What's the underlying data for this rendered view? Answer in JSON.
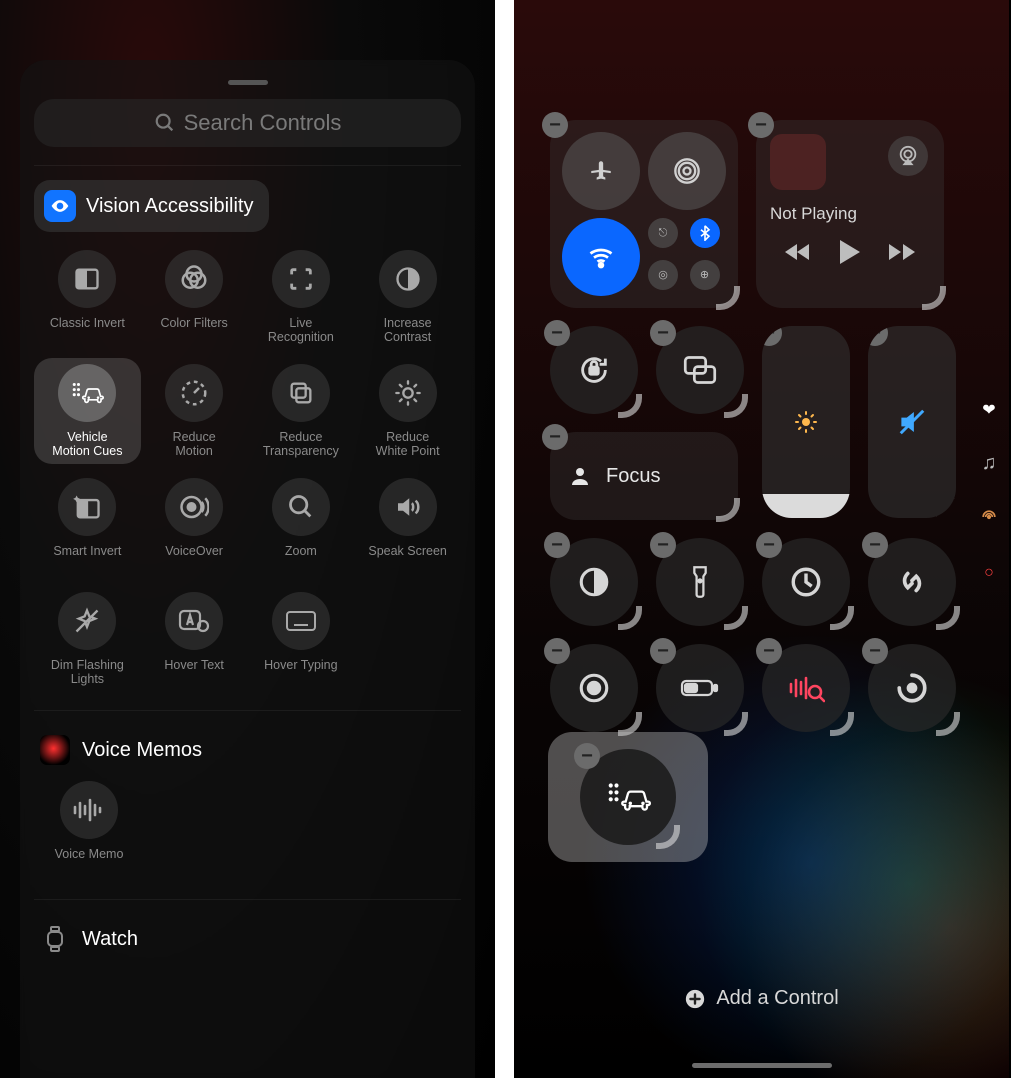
{
  "left": {
    "search_placeholder": "Search Controls",
    "section_vision": "Vision Accessibility",
    "tiles": [
      {
        "label": "Classic Invert"
      },
      {
        "label": "Color Filters"
      },
      {
        "label": "Live\nRecognition"
      },
      {
        "label": "Increase\nContrast"
      },
      {
        "label": "Vehicle\nMotion Cues",
        "highlight": true
      },
      {
        "label": "Reduce\nMotion"
      },
      {
        "label": "Reduce\nTransparency"
      },
      {
        "label": "Reduce\nWhite Point"
      },
      {
        "label": "Smart Invert"
      },
      {
        "label": "VoiceOver"
      },
      {
        "label": "Zoom"
      },
      {
        "label": "Speak Screen"
      },
      {
        "label": "Dim Flashing\nLights"
      },
      {
        "label": "Hover Text"
      },
      {
        "label": "Hover Typing"
      }
    ],
    "section_memos": "Voice Memos",
    "voice_memo_tile": "Voice Memo",
    "section_watch": "Watch"
  },
  "right": {
    "not_playing": "Not Playing",
    "focus_label": "Focus",
    "add_control": "Add a Control"
  }
}
